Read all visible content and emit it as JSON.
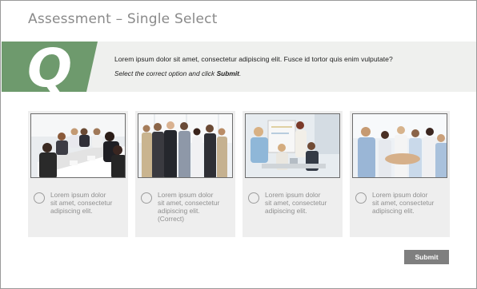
{
  "header": {
    "title": "Assessment – Single Select"
  },
  "question": {
    "badge_letter": "Q",
    "text": "Lorem ipsum dolor sit amet, consectetur adipiscing elit. Fusce id tortor quis enim vulputate?",
    "instruction_prefix": "Select the correct option and click ",
    "instruction_action": "Submit",
    "instruction_suffix": ".",
    "badge_color": "#6e9a6d"
  },
  "options": [
    {
      "line1": "Lorem ipsum dolor",
      "line2": "sit amet, consectetur",
      "line3": "adipiscing elit.",
      "line4": "",
      "photo_icon": "business-meeting-photo"
    },
    {
      "line1": "Lorem ipsum dolor",
      "line2": "sit amet, consectetur",
      "line3": "adipiscing elit.",
      "line4": "(Correct)",
      "photo_icon": "team-group-photo"
    },
    {
      "line1": "Lorem ipsum dolor",
      "line2": "sit amet, consectetur",
      "line3": "adipiscing elit.",
      "line4": "",
      "photo_icon": "presentation-photo"
    },
    {
      "line1": "Lorem ipsum dolor",
      "line2": "sit amet, consectetur",
      "line3": "adipiscing elit.",
      "line4": "",
      "photo_icon": "team-huddle-photo"
    }
  ],
  "actions": {
    "submit_label": "Submit",
    "submit_color": "#7f7f7f"
  }
}
